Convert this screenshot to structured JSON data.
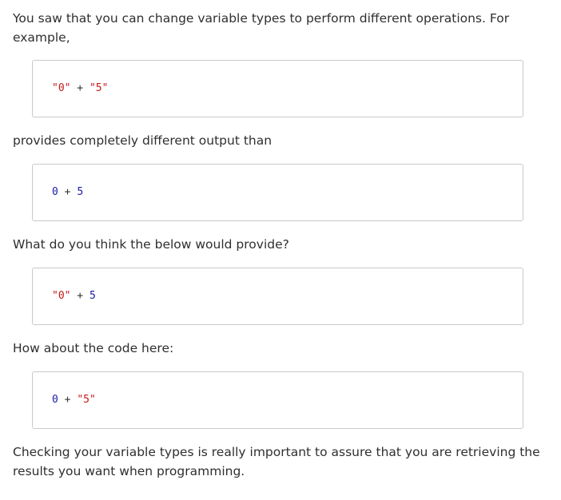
{
  "paragraphs": {
    "intro": "You saw that you can change variable types to perform different operations. For example,",
    "after_first": "provides completely different output than",
    "question": "What do you think the below would provide?",
    "how_about": "How about the code here:",
    "conclusion": "Checking your variable types is really important to assure that you are retrieving the results you want when programming."
  },
  "code_blocks": [
    {
      "left": "\"0\"",
      "op": " + ",
      "right": "\"5\""
    },
    {
      "left": "0",
      "op": " + ",
      "right": "5"
    },
    {
      "left": "\"0\"",
      "op": " + ",
      "right": "5"
    },
    {
      "left": "0",
      "op": " + ",
      "right": "\"5\""
    }
  ],
  "colors": {
    "string_token": "#c41a16",
    "number_token": "#1a1aa6",
    "code_border": "#c9c9c9",
    "text": "#2f2f2f"
  }
}
